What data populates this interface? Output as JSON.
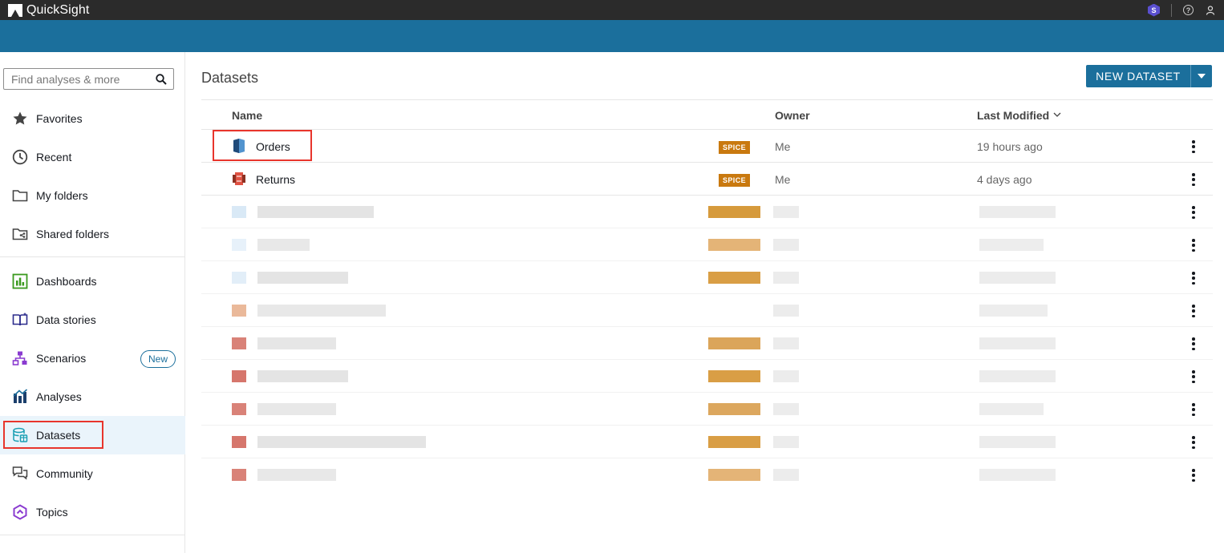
{
  "app": {
    "title": "QuickSight",
    "top_icons": [
      "hexagon-badge-icon",
      "help-icon",
      "user-icon"
    ],
    "colors": {
      "topbar": "#2b2b2b",
      "brand_bar": "#1b6f9c",
      "accent": "#1b6f9c",
      "spice": "#c9790f",
      "highlight": "#e8352c"
    }
  },
  "sidebar": {
    "search": {
      "placeholder": "Find analyses & more",
      "value": ""
    },
    "items": [
      {
        "label": "Favorites",
        "icon": "star-icon"
      },
      {
        "label": "Recent",
        "icon": "clock-icon"
      },
      {
        "label": "My folders",
        "icon": "folder-icon"
      },
      {
        "label": "Shared folders",
        "icon": "shared-folder-icon"
      },
      {
        "label": "Dashboards",
        "icon": "dashboard-icon"
      },
      {
        "label": "Data stories",
        "icon": "book-icon"
      },
      {
        "label": "Scenarios",
        "icon": "scenarios-icon",
        "badge": "New"
      },
      {
        "label": "Analyses",
        "icon": "analyses-icon"
      },
      {
        "label": "Datasets",
        "icon": "datasets-icon",
        "active": true
      },
      {
        "label": "Community",
        "icon": "chat-icon"
      },
      {
        "label": "Topics",
        "icon": "topics-icon"
      }
    ]
  },
  "main": {
    "title": "Datasets",
    "new_dataset_label": "NEW DATASET",
    "columns": {
      "name": "Name",
      "owner": "Owner",
      "last_modified": "Last Modified"
    },
    "rows": [
      {
        "name": "Orders",
        "badge": "SPICE",
        "owner": "Me",
        "last_modified": "19 hours ago",
        "icon": "redshift-icon"
      },
      {
        "name": "Returns",
        "badge": "SPICE",
        "owner": "Me",
        "last_modified": "4 days ago",
        "icon": "s3-icon"
      }
    ]
  }
}
